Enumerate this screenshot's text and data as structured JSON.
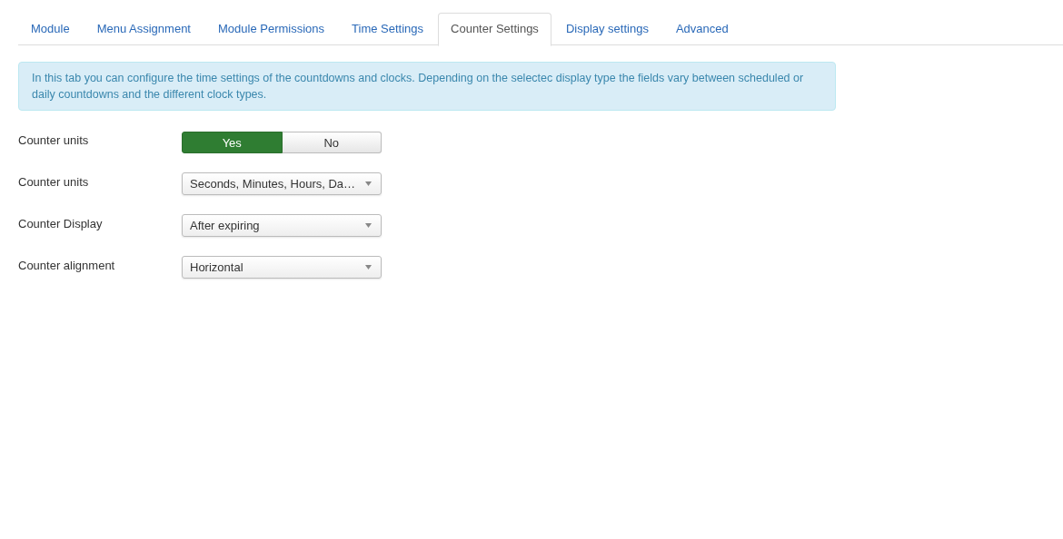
{
  "tabs": [
    {
      "label": "Module",
      "selected": false
    },
    {
      "label": "Menu Assignment",
      "selected": false
    },
    {
      "label": "Module Permissions",
      "selected": false
    },
    {
      "label": "Time Settings",
      "selected": false
    },
    {
      "label": "Counter Settings",
      "selected": true
    },
    {
      "label": "Display settings",
      "selected": false
    },
    {
      "label": "Advanced",
      "selected": false
    }
  ],
  "info": "In this tab you can configure the time settings of the countdowns and clocks. Depending on the selectec display type the fields vary between scheduled or daily countdowns and the different clock types.",
  "fields": [
    {
      "label": "Counter units",
      "kind": "toggle",
      "options": [
        {
          "label": "Yes",
          "selected": true
        },
        {
          "label": "No",
          "selected": false
        }
      ]
    },
    {
      "label": "Counter units",
      "kind": "select",
      "value": "Seconds, Minutes, Hours, Da…"
    },
    {
      "label": "Counter Display",
      "kind": "select",
      "value": "After expiring"
    },
    {
      "label": "Counter alignment",
      "kind": "select",
      "value": "Horizontal"
    }
  ]
}
